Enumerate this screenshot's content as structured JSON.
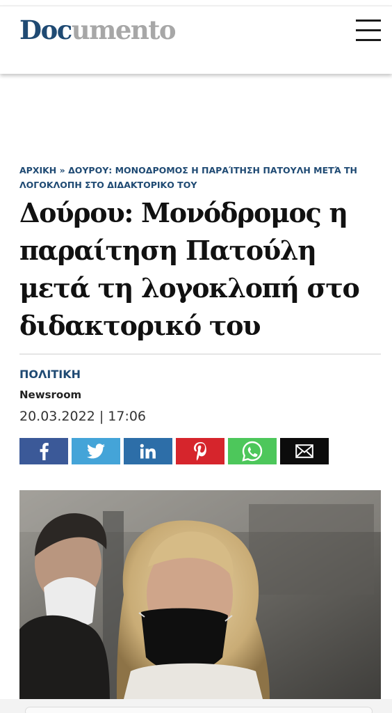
{
  "header": {
    "logo_part1": "Doc",
    "logo_part2": "umento"
  },
  "breadcrumb": {
    "home": "ΑΡΧΙΚΗ",
    "separator": "»",
    "current": "ΔΟΥΡΟΥ: ΜΟΝΟΔΡΟΜΟΣ Η ΠΑΡΑΊΤΗΣΗ ΠΑΤΟΥΛΗ ΜΕΤΆ ΤΗ ΛΟΓΟΚΛΟΠΗ ΣΤΟ ΔΙΔΑΚΤΟΡΙΚΟ ΤΟΥ"
  },
  "article": {
    "title": "Δούρου: Μονόδρομος η παραίτηση Πατούλη μετά τη λογοκλοπή στο διδακτορικό του",
    "category": "ΠΟΛΙΤΙΚΗ",
    "author": "Newsroom",
    "date": "20.03.2022 | 17:06"
  },
  "share": [
    {
      "name": "facebook",
      "icon": "facebook-icon",
      "color": "#3b5998"
    },
    {
      "name": "twitter",
      "icon": "twitter-icon",
      "color": "#44a4d8"
    },
    {
      "name": "linkedin",
      "icon": "linkedin-icon",
      "color": "#2d6ea8"
    },
    {
      "name": "pinterest",
      "icon": "pinterest-icon",
      "color": "#d6252c"
    },
    {
      "name": "whatsapp",
      "icon": "whatsapp-icon",
      "color": "#4dc75b"
    },
    {
      "name": "email",
      "icon": "email-icon",
      "color": "#0c0c0c"
    }
  ],
  "colors": {
    "brand_blue": "#1f4a73",
    "brand_gray": "#a7a7a7"
  }
}
